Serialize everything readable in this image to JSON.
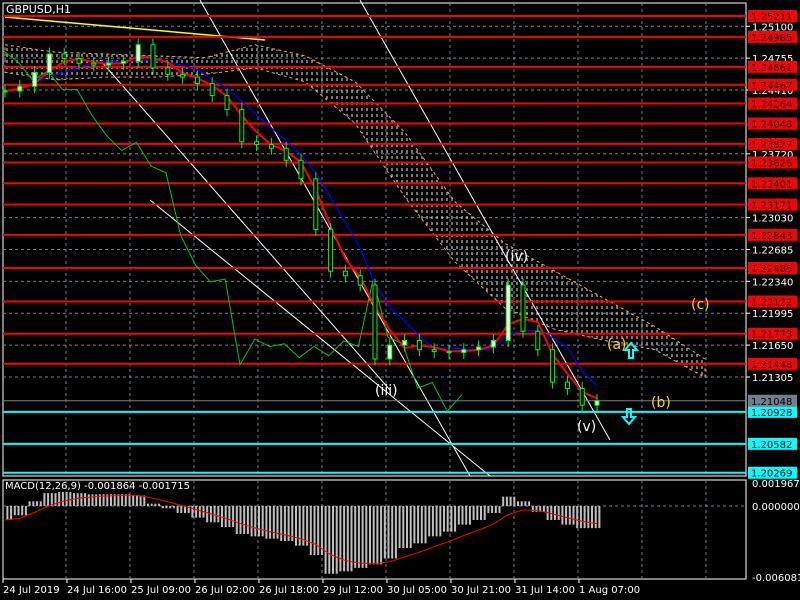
{
  "title": "GBPUSD,H1",
  "macd_label": "MACD(12,26,9) -0.001864 -0.001715",
  "colors": {
    "bg": "#000000",
    "bull": "#00ff00",
    "bear": "#ffffff",
    "level": "#ff0000",
    "support": "#00ffff",
    "ma_fast": "#ff0000",
    "ma_slow": "#0000ff",
    "chikou": "#00cc00",
    "trend": "#ffff00",
    "current": "#708090"
  },
  "wave_labels": {
    "iii": "(iii)",
    "iv": "(iv)",
    "v": "(v)",
    "a": "(a)",
    "b": "(b)",
    "c": "(c)"
  },
  "icons": {
    "up": "arrow-up-icon",
    "down": "arrow-down-icon"
  },
  "chart_data": {
    "type": "line",
    "title": "GBPUSD,H1",
    "closes": [
      1.244,
      1.2445,
      1.246,
      1.248,
      1.2475,
      1.247,
      1.2468,
      1.247,
      1.2472,
      1.249,
      1.2465,
      1.2458,
      1.2455,
      1.2448,
      1.2435,
      1.242,
      1.2385,
      1.2382,
      1.2378,
      1.2365,
      1.2345,
      1.229,
      1.2245,
      1.224,
      1.223,
      1.215,
      1.2165,
      1.217,
      1.216,
      1.2158,
      1.2157,
      1.216,
      1.2163,
      1.217,
      1.223,
      1.218,
      1.216,
      1.2125,
      1.2118,
      1.21,
      1.21048
    ],
    "cloud_upper": [
      1.249,
      1.2482,
      1.248,
      1.2478,
      1.2476,
      1.249,
      1.2478,
      1.245,
      1.2395,
      1.232,
      1.2275,
      1.2245,
      1.2215,
      1.2185,
      1.215
    ],
    "cloud_lower": [
      1.246,
      1.2452,
      1.2455,
      1.2455,
      1.2458,
      1.2465,
      1.245,
      1.2405,
      1.2325,
      1.2255,
      1.2205,
      1.2182,
      1.217,
      1.216,
      1.213
    ],
    "resistance_levels": [
      "1.25211",
      "1.24985",
      "1.24661",
      "1.24467",
      "1.24264",
      "1.24048",
      "1.23827",
      "1.23626",
      "1.23401",
      "1.23171",
      "1.22843",
      "1.22485",
      "1.22122",
      "1.21773",
      "1.21448"
    ],
    "support_levels": [
      "1.20928",
      "1.20582",
      "1.20269"
    ],
    "current_price": "1.21048",
    "price_ticks": [
      "1.25100",
      "1.24755",
      "1.24410",
      "1.23720",
      "1.23030",
      "1.22685",
      "1.22340",
      "1.21995",
      "1.21650",
      "1.21305"
    ],
    "ylim": [
      1.2016,
      1.2545
    ],
    "time_labels": [
      "24 Jul 2019",
      "24 Jul 16:00",
      "25 Jul 09:00",
      "26 Jul 02:00",
      "26 Jul 18:00",
      "29 Jul 12:00",
      "30 Jul 05:00",
      "30 Jul 21:00",
      "31 Jul 14:00",
      "1 Aug 07:00"
    ],
    "macd": {
      "histogram": [
        -0.0012,
        -0.0008,
        0.0004,
        0.0011,
        0.0012,
        0.0011,
        0.001,
        0.001,
        0.001,
        0.0009,
        0.0002,
        -0.0002,
        -0.0006,
        -0.001,
        -0.0014,
        -0.0018,
        -0.0024,
        -0.0026,
        -0.0028,
        -0.003,
        -0.0034,
        -0.0042,
        -0.0058,
        -0.0056,
        -0.0053,
        -0.005,
        -0.0045,
        -0.0036,
        -0.0032,
        -0.0026,
        -0.0022,
        -0.0016,
        -0.0012,
        -0.0006,
        0.0008,
        0.0004,
        -0.0005,
        -0.0012,
        -0.0016,
        -0.0019,
        -0.0019
      ],
      "ticks": [
        "0.001967",
        "0.000000",
        "-0.006081"
      ],
      "ylim": [
        -0.006081,
        0.001967
      ]
    }
  }
}
